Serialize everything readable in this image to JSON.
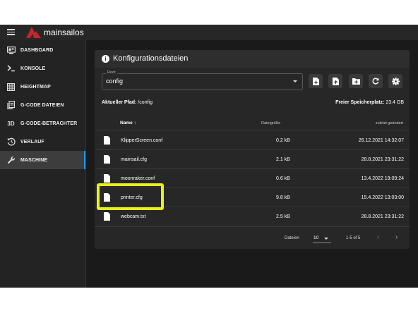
{
  "app": {
    "name": "mainsailos"
  },
  "sidebar": {
    "items": [
      {
        "label": "DASHBOARD",
        "icon": "dashboard-icon"
      },
      {
        "label": "KONSOLE",
        "icon": "console-icon"
      },
      {
        "label": "HEIGHTMAP",
        "icon": "grid-icon"
      },
      {
        "label": "G-CODE DATEIEN",
        "icon": "file-document-icon"
      },
      {
        "label": "G-CODE-BETRACHTER",
        "icon": "3d-icon",
        "icon_text": "3D"
      },
      {
        "label": "VERLAUF",
        "icon": "history-icon"
      },
      {
        "label": "MASCHINE",
        "icon": "wrench-icon",
        "active": true
      }
    ]
  },
  "panel": {
    "title": "Konfigurationsdateien",
    "root_label": "Root",
    "root_value": "config",
    "toolbar": [
      "add-file-icon",
      "upload-file-icon",
      "add-folder-icon",
      "refresh-icon",
      "settings-icon"
    ],
    "path_label": "Aktueller Pfad:",
    "path_value": "/config",
    "free_space_label": "Freier Speicherplatz:",
    "free_space_value": "23.4 GB"
  },
  "table": {
    "headers": {
      "name": "Name",
      "sort_icon": "↑",
      "size": "Dateigröße",
      "modified": "zuletzt geändert"
    },
    "rows": [
      {
        "name": "KlipperScreen.conf",
        "size": "0.2 kB",
        "modified": "26.12.2021 14:32:07"
      },
      {
        "name": "mainsail.cfg",
        "size": "2.1 kB",
        "modified": "28.8.2021 23:31:22"
      },
      {
        "name": "moonraker.conf",
        "size": "0.6 kB",
        "modified": "13.4.2022 19:09:24"
      },
      {
        "name": "printer.cfg",
        "size": "9.8 kB",
        "modified": "15.4.2022 13:03:00"
      },
      {
        "name": "webcam.txt",
        "size": "2.5 kB",
        "modified": "28.8.2021 23:31:22"
      }
    ]
  },
  "footer": {
    "per_page_label": "Dateien",
    "per_page_value": "10",
    "range": "1-5 of 5",
    "prev": "‹",
    "next": "›"
  },
  "colors": {
    "accent": "#2196f3",
    "highlight": "#e7f218",
    "logo": "#c0272d"
  }
}
